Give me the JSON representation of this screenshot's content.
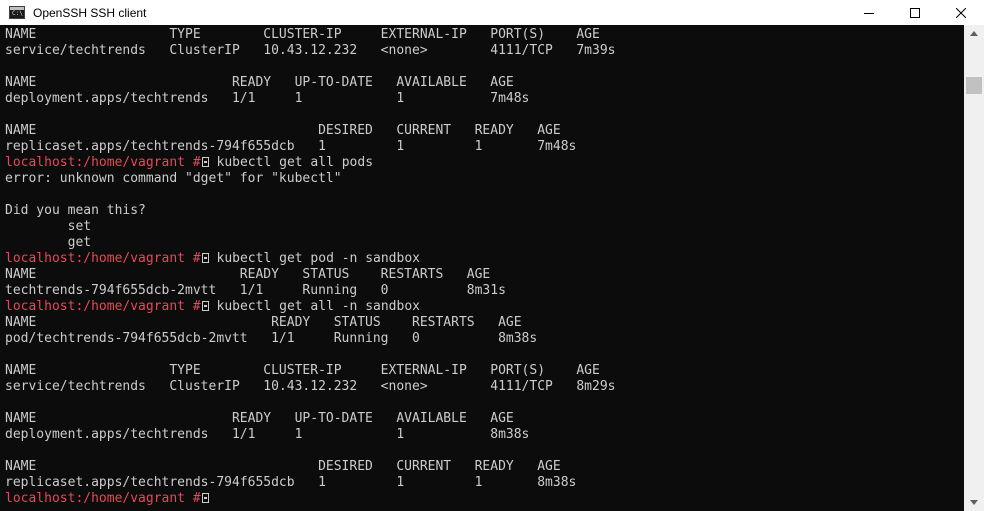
{
  "window": {
    "title": "OpenSSH SSH client",
    "icon": "console-app-icon",
    "icon_text": "C:\\",
    "controls": {
      "minimize": "minimize-icon",
      "maximize": "maximize-icon",
      "close": "close-icon"
    }
  },
  "terminal": {
    "colors": {
      "background": "#0c0c0c",
      "text": "#cccccc",
      "prompt": "#e74856"
    },
    "prompt": "localhost:/home/vagrant #",
    "lines": [
      {
        "text": "NAME                 TYPE        CLUSTER-IP     EXTERNAL-IP   PORT(S)    AGE"
      },
      {
        "text": "service/techtrends   ClusterIP   10.43.12.232   <none>        4111/TCP   7m39s"
      },
      {
        "text": ""
      },
      {
        "text": "NAME                         READY   UP-TO-DATE   AVAILABLE   AGE"
      },
      {
        "text": "deployment.apps/techtrends   1/1     1            1           7m48s"
      },
      {
        "text": ""
      },
      {
        "text": "NAME                                    DESIRED   CURRENT   READY   AGE"
      },
      {
        "text": "replicaset.apps/techtrends-794f655dcb   1         1         1       7m48s"
      },
      {
        "prompt": "localhost:/home/vagrant #",
        "text": " kubectl get all pods"
      },
      {
        "text": "error: unknown command \"dget\" for \"kubectl\""
      },
      {
        "text": ""
      },
      {
        "text": "Did you mean this?"
      },
      {
        "text": "        set"
      },
      {
        "text": "        get"
      },
      {
        "prompt": "localhost:/home/vagrant #",
        "text": " kubectl get pod -n sandbox"
      },
      {
        "text": "NAME                          READY   STATUS    RESTARTS   AGE"
      },
      {
        "text": "techtrends-794f655dcb-2mvtt   1/1     Running   0          8m31s"
      },
      {
        "prompt": "localhost:/home/vagrant #",
        "text": " kubectl get all -n sandbox"
      },
      {
        "text": "NAME                              READY   STATUS    RESTARTS   AGE"
      },
      {
        "text": "pod/techtrends-794f655dcb-2mvtt   1/1     Running   0          8m38s"
      },
      {
        "text": ""
      },
      {
        "text": "NAME                 TYPE        CLUSTER-IP     EXTERNAL-IP   PORT(S)    AGE"
      },
      {
        "text": "service/techtrends   ClusterIP   10.43.12.232   <none>        4111/TCP   8m29s"
      },
      {
        "text": ""
      },
      {
        "text": "NAME                         READY   UP-TO-DATE   AVAILABLE   AGE"
      },
      {
        "text": "deployment.apps/techtrends   1/1     1            1           8m38s"
      },
      {
        "text": ""
      },
      {
        "text": "NAME                                    DESIRED   CURRENT   READY   AGE"
      },
      {
        "text": "replicaset.apps/techtrends-794f655dcb   1         1         1       8m38s"
      },
      {
        "prompt": "localhost:/home/vagrant #",
        "text": ""
      }
    ]
  },
  "scrollbar": {
    "up": "scroll-up-arrow-icon",
    "down": "scroll-down-arrow-icon"
  }
}
